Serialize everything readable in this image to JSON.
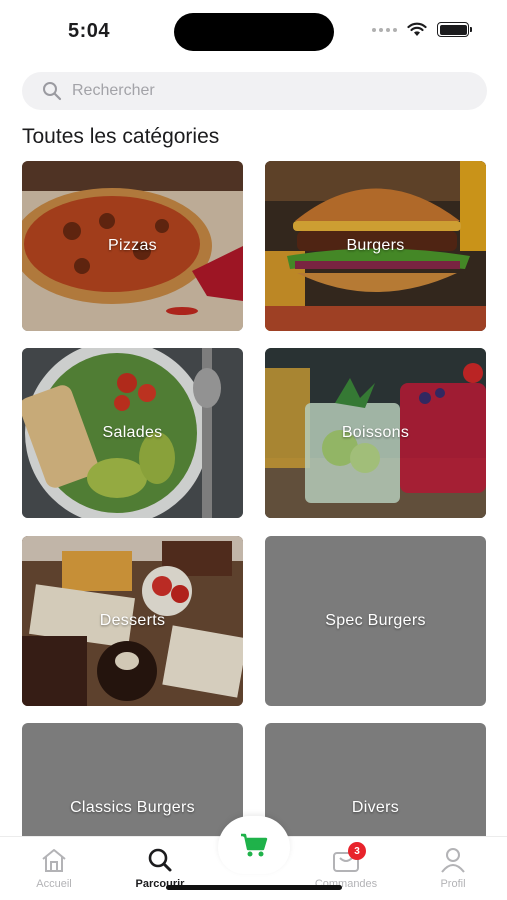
{
  "status_bar": {
    "time": "5:04"
  },
  "search": {
    "placeholder": "Rechercher"
  },
  "section_title": "Toutes les catégories",
  "categories": [
    {
      "label": "Pizzas",
      "image": "pizza-photo"
    },
    {
      "label": "Burgers",
      "image": "burger-photo"
    },
    {
      "label": "Salades",
      "image": "salad-photo"
    },
    {
      "label": "Boissons",
      "image": "drinks-photo"
    },
    {
      "label": "Desserts",
      "image": "desserts-photo"
    },
    {
      "label": "Spec Burgers",
      "image": "none"
    },
    {
      "label": "Classics Burgers",
      "image": "none"
    },
    {
      "label": "Divers",
      "image": "none"
    }
  ],
  "tabs": [
    {
      "label": "Accueil",
      "icon": "home-icon",
      "active": false
    },
    {
      "label": "Parcourir",
      "icon": "search-icon",
      "active": true
    },
    {
      "label": "",
      "icon": "cart-icon",
      "active": false
    },
    {
      "label": "Commandes",
      "icon": "orders-icon",
      "active": false,
      "badge": "3"
    },
    {
      "label": "Profil",
      "icon": "user-icon",
      "active": false
    }
  ],
  "colors": {
    "accent_green": "#1fb24a",
    "badge_red": "#e8232b",
    "placeholder_tile": "#7b7b7b"
  }
}
